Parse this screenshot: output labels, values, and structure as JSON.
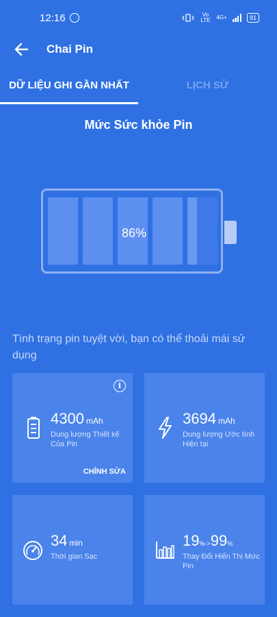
{
  "status_bar": {
    "time": "12:16",
    "network_label": "Vo LTE",
    "net_4g": "4G+",
    "battery": "91"
  },
  "header": {
    "title": "Chai Pin"
  },
  "tabs": [
    {
      "label": "DỮ LIỆU GHI GẦN NHẤT",
      "active": true
    },
    {
      "label": "LỊCH SỬ",
      "active": false
    }
  ],
  "health": {
    "title": "Mức Sức khỏe Pin",
    "percent": "86%",
    "level": 0.86
  },
  "status_text": "Tình trạng pin tuyệt vời, bạn có thể thoải mái sử dụng",
  "cards": {
    "design_capacity": {
      "value": "4300",
      "unit": "mAh",
      "label": "Dung lượng Thiết kế Của Pin",
      "edit_label": "CHỈNH SỬA",
      "icon": "battery-icon"
    },
    "estimated_capacity": {
      "value": "3694",
      "unit": "mAh",
      "label": "Dung lượng Ước tính Hiện tại",
      "icon": "lightning-icon"
    },
    "charge_time": {
      "value": "34",
      "unit": "min",
      "label": "Thời gian Sạc",
      "icon": "speedometer-icon"
    },
    "display_change": {
      "from_value": "19",
      "arrow": "%->",
      "to_value": "99",
      "to_unit": "%",
      "label": "Thay Đổi Hiển Thị Mức Pin",
      "icon": "bar-chart-icon"
    }
  },
  "colors": {
    "background": "#2f71e3",
    "card": "#4a83ea",
    "inactive_tab": "#7aa3ee"
  }
}
